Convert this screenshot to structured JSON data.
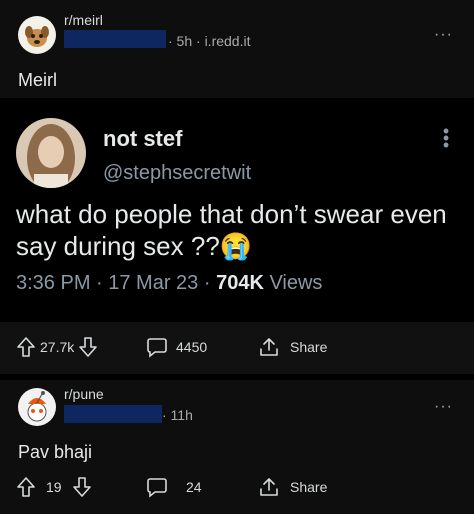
{
  "post1": {
    "subreddit": "r/meirl",
    "meta": "· 5h · i.redd.it",
    "title": "Meirl",
    "more_label": "···"
  },
  "tweet": {
    "name": "not stef",
    "handle": "@stephsecretwit",
    "text": "what do people that don’t swear even say during sex ??😭",
    "time": "3:36 PM · 17 Mar 23 · ",
    "views_count": "704K",
    "views_label": " Views",
    "more_label": "·\n·\n·"
  },
  "actions1": {
    "votes": "27.7k",
    "comments": "4450",
    "share": "Share"
  },
  "post2": {
    "subreddit": "r/pune",
    "meta": "· 11h",
    "title": "Pav bhaji",
    "more_label": "···",
    "votes": "19",
    "comments": "24",
    "share": "Share"
  },
  "colors": {
    "background": "#000000",
    "card": "#0e0e0e",
    "redaction": "#0f2760",
    "muted_text": "#8b98a5"
  },
  "icons": [
    "dog-avatar-icon",
    "snoo-avatar-icon",
    "upvote-icon",
    "downvote-icon",
    "comment-icon",
    "share-icon",
    "more-icon"
  ]
}
